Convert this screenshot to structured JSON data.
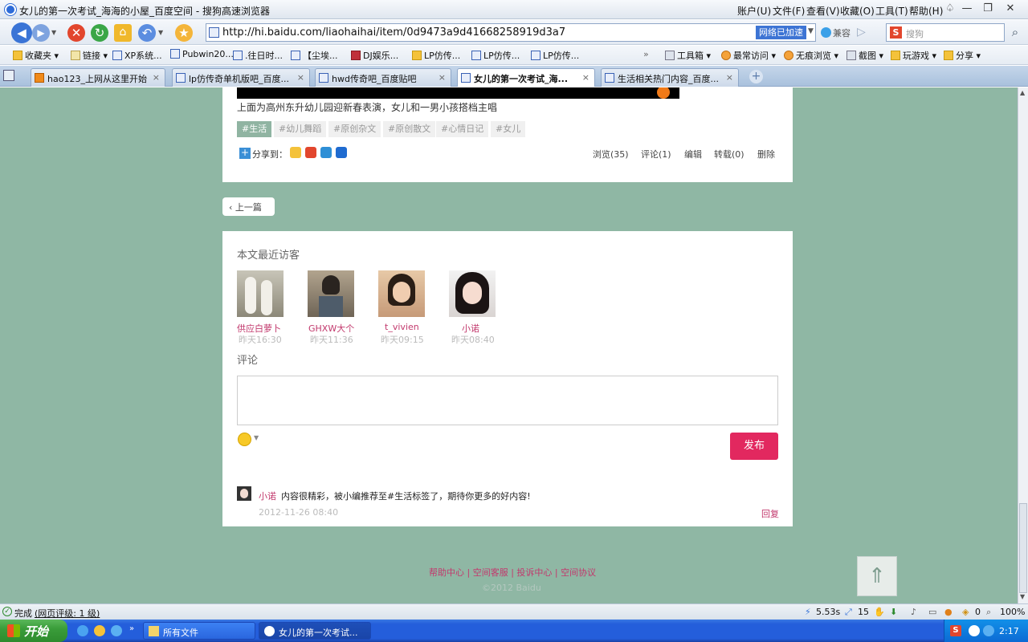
{
  "window": {
    "title": "女儿的第一次考试_海海的小屋_百度空间 - 搜狗高速浏览器",
    "menu": [
      "账户(U)",
      "文件(F)",
      "查看(V)",
      "收藏(O)",
      "工具(T)",
      "帮助(H)"
    ]
  },
  "navbar": {
    "url": "http://hi.baidu.com/liaohaihai/item/0d9473a9d41668258919d3a7",
    "accelerated": "网络已加速",
    "compat": "兼容",
    "search_placeholder": "搜狗"
  },
  "bookmarks": [
    "收藏夹",
    "链接",
    "XP系统...",
    "Pubwin20...",
    ".往日时...",
    "【尘埃...",
    "DJ娱乐...",
    "LP仿传...",
    "LP仿传...",
    "LP仿传..."
  ],
  "bookmarks_right": [
    "工具箱",
    "最常访问",
    "无痕浏览",
    "截图",
    "玩游戏",
    "分享"
  ],
  "tabs": [
    {
      "label": "hao123_上网从这里开始",
      "active": false
    },
    {
      "label": "lp仿传奇单机版吧_百度...",
      "active": false
    },
    {
      "label": "hwd传奇吧_百度贴吧",
      "active": false
    },
    {
      "label": "女儿的第一次考试_海...",
      "active": true
    },
    {
      "label": "生活相关热门内容_百度...",
      "active": false
    }
  ],
  "post": {
    "caption": "上面为高州东升幼儿园迎新春表演，女儿和一男小孩搭档主唱",
    "tags": [
      "#生活",
      "#幼儿舞蹈",
      "#原创杂文",
      "#原创散文",
      "#心情日记",
      "#女儿"
    ],
    "share_label": "分享到：",
    "actions": {
      "views": "浏览(35)",
      "comments": "评论(1)",
      "edit": "编辑",
      "repost": "转载(0)",
      "delete": "删除"
    },
    "prev": "上一篇"
  },
  "visitors": {
    "heading": "本文最近访客",
    "items": [
      {
        "name": "供应白萝卜",
        "time": "昨天16:30"
      },
      {
        "name": "GHXW大个",
        "time": "昨天11:36"
      },
      {
        "name": "t_vivien",
        "time": "昨天09:15"
      },
      {
        "name": "小诺",
        "time": "昨天08:40"
      }
    ]
  },
  "comments": {
    "heading": "评论",
    "publish": "发布",
    "list": [
      {
        "user": "小诺",
        "text": "内容很精彩，被小编推荐至#生活标签了，期待你更多的好内容!",
        "date": "2012-11-26 08:40",
        "reply": "回复"
      }
    ]
  },
  "footer": {
    "links": "帮助中心 | 空间客服 | 投诉中心 | 空间协议",
    "copyright": "©2012 Baidu"
  },
  "status": {
    "text": "完成",
    "rating": "(网页评级: 1 级)",
    "speed": "5.53s",
    "count": "15",
    "zero": "0",
    "zoom": "100%"
  },
  "taskbar": {
    "start": "开始",
    "tasks": [
      "所有文件",
      "女儿的第一次考试..."
    ],
    "clock": "2:17"
  },
  "colors": {
    "page_bg": "#8fb7a4",
    "accent": "#c2386c",
    "publish": "#e2285f"
  }
}
